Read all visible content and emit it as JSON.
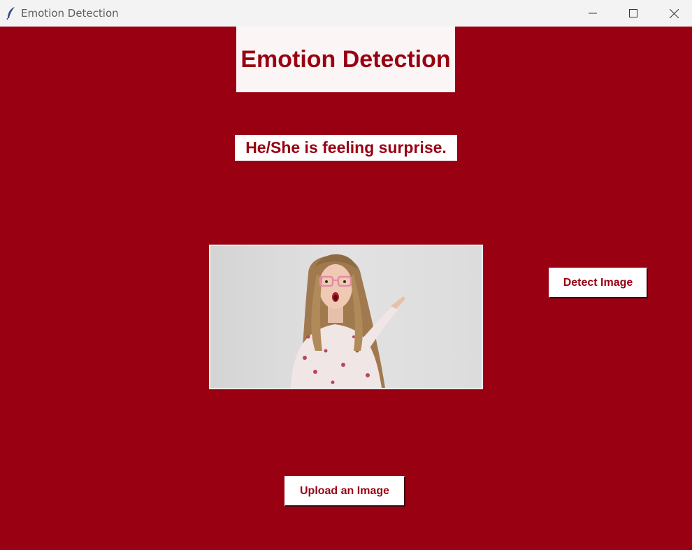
{
  "window": {
    "title": "Emotion Detection",
    "controls": {
      "minimize": "minimize",
      "maximize": "maximize",
      "close": "close"
    }
  },
  "heading": {
    "text": "Emotion Detection"
  },
  "result": {
    "text": "He/She is feeling surprise."
  },
  "buttons": {
    "detect_label": "Detect Image",
    "upload_label": "Upload an Image"
  },
  "photo": {
    "description_icon": "uploaded-photo"
  },
  "colors": {
    "background": "#990012",
    "text_accent": "#990012",
    "title_bar": "#f3f3f3"
  }
}
